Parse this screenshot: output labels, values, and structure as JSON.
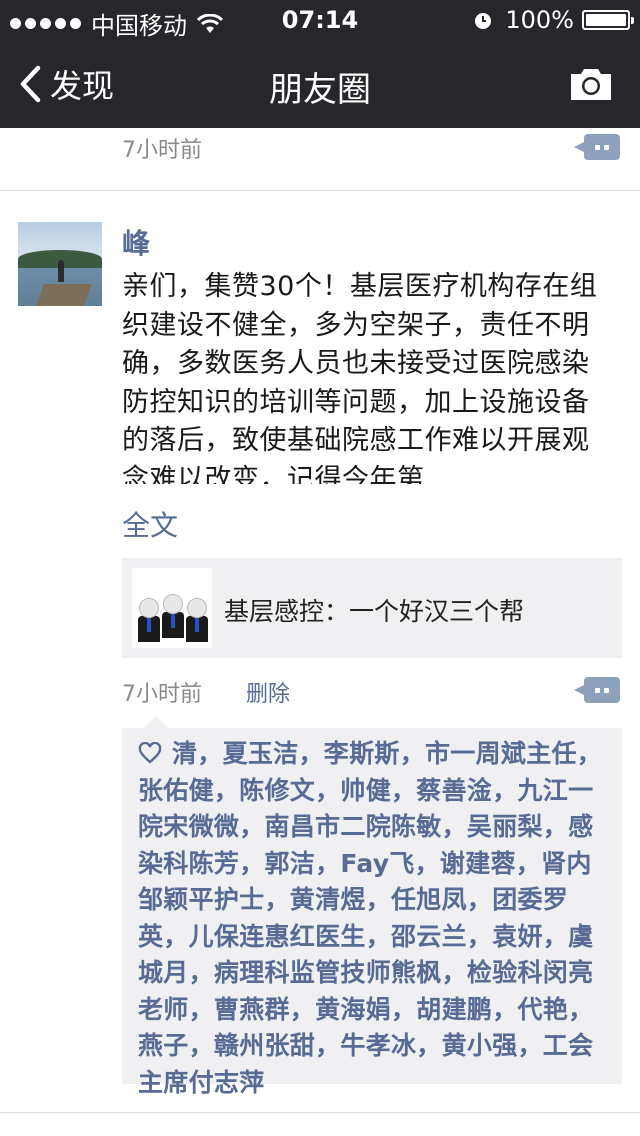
{
  "status_bar": {
    "carrier": "中国移动",
    "time": "07:14",
    "battery_percent": "100%",
    "battery_level": 1.0
  },
  "nav": {
    "back_label": "发现",
    "title": "朋友圈",
    "right_icon": "camera-icon"
  },
  "previous_post": {
    "time": "7小时前"
  },
  "post": {
    "user_name": "峰",
    "text": "亲们，集赞30个！基层医疗机构存在组织建设不健全，多为空架子，责任不明确，多数医务人员也未接受过医院感染防控知识的培训等问题，加上设施设备的落后，致使基础院感工作难以开展观念难以改变，记得今年第",
    "full_text_label": "全文",
    "link": {
      "title": "基层感控：一个好汉三个帮"
    },
    "time": "7小时前",
    "delete_label": "删除",
    "likes": "清，夏玉洁，李斯斯，市一周斌主任，张佑健，陈修文，帅健，蔡善淦，九江一院宋微微，南昌市二院陈敏，吴丽梨，感染科陈芳，郭洁，Fay飞，谢建蓉，肾内邹颖平护士，黄清煜，任旭凤，团委罗英，儿保连惠红医生，邵云兰，袁妍，虞城月，病理科监管技师熊枫，检验科闵亮老师，曹燕群，黄海娟，胡建鹏，代艳，燕子，赣州张甜，牛孝冰，黄小强，工会主席付志萍"
  },
  "colors": {
    "bar_background": "#27272b",
    "link_blue": "#576b95",
    "comment_button": "#8da1bd",
    "card_background": "#f0f0f2"
  }
}
